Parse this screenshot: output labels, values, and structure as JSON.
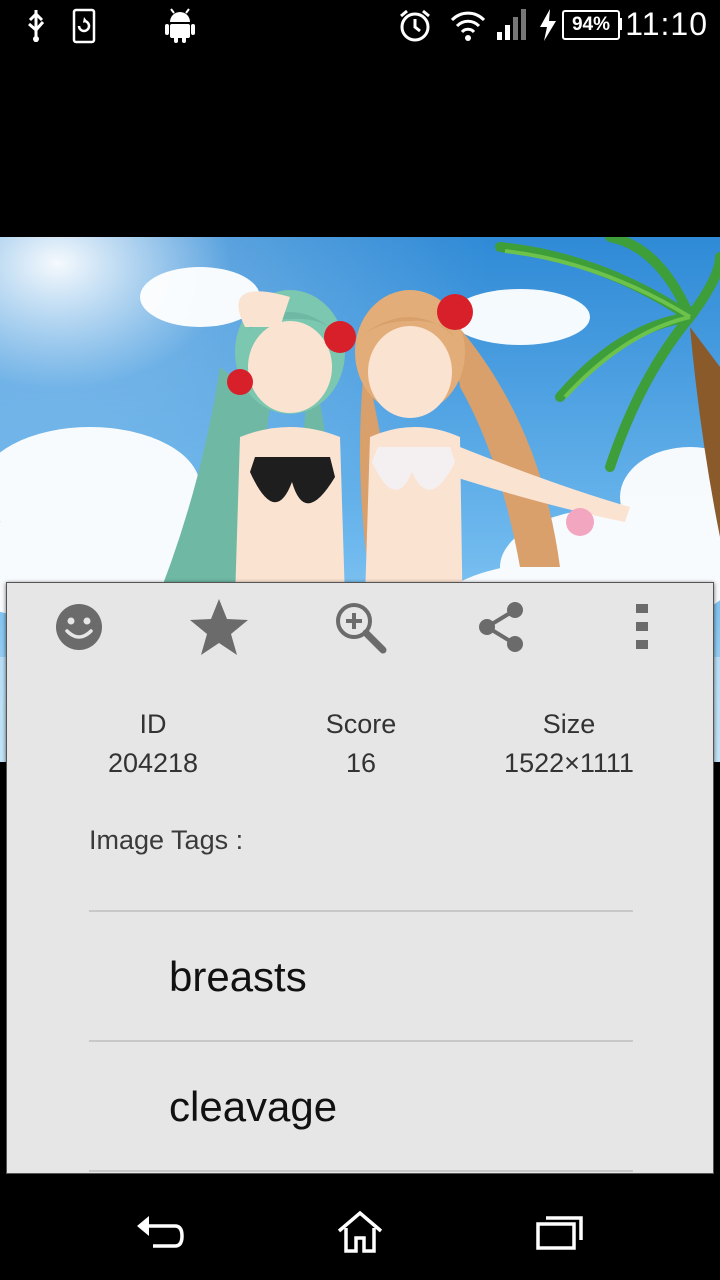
{
  "status_bar": {
    "battery_percent": "94%",
    "time": "11:10",
    "icons": [
      "usb-icon",
      "screen-rotate-icon",
      "android-icon",
      "alarm-icon",
      "wifi-icon",
      "signal-icon",
      "charging-icon",
      "battery-icon"
    ]
  },
  "toolbar": {
    "buttons": [
      "smiley-icon",
      "star-icon",
      "zoom-in-icon",
      "share-icon",
      "overflow-menu-icon"
    ]
  },
  "info": {
    "id_label": "ID",
    "id_value": "204218",
    "score_label": "Score",
    "score_value": "16",
    "size_label": "Size",
    "size_value": "1522×1111"
  },
  "tags": {
    "label": "Image Tags :",
    "items": [
      "breasts",
      "cleavage"
    ]
  },
  "nav_bar": {
    "buttons": [
      "back-icon",
      "home-icon",
      "recent-apps-icon"
    ]
  },
  "colors": {
    "panel_bg": "#e6e6e6",
    "icon_gray": "#6b6b6b",
    "sky_blue": "#3f9be0"
  }
}
